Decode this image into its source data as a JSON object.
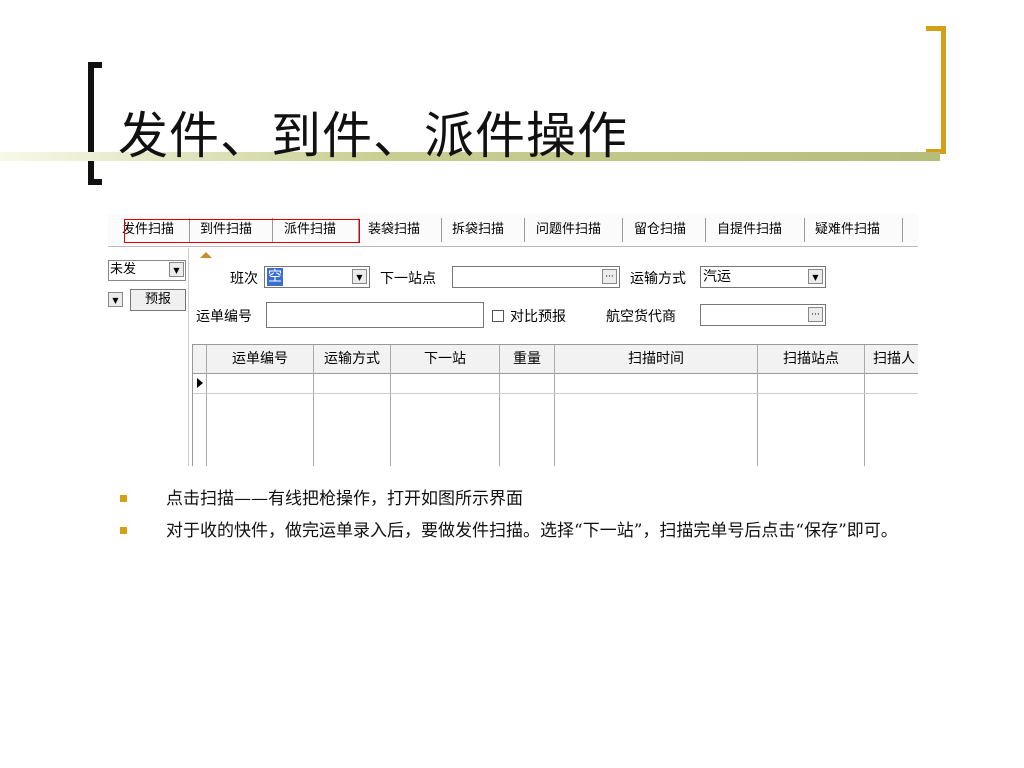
{
  "slide": {
    "title": "发件、到件、派件操作",
    "accent_color": "#d4a017"
  },
  "app": {
    "tabs": [
      {
        "label": "发件扫描"
      },
      {
        "label": "到件扫描"
      },
      {
        "label": "派件扫描"
      },
      {
        "label": "装袋扫描"
      },
      {
        "label": "拆袋扫描"
      },
      {
        "label": "问题件扫描"
      },
      {
        "label": "留仓扫描"
      },
      {
        "label": "自提件扫描"
      },
      {
        "label": "疑难件扫描"
      }
    ],
    "left_panel": {
      "status_value": "未发",
      "preview_button": "预报"
    },
    "form": {
      "shift_label": "班次",
      "shift_value": "空",
      "next_station_label": "下一站点",
      "next_station_value": "",
      "transport_label": "运输方式",
      "transport_value": "汽运",
      "waybill_label": "运单编号",
      "waybill_value": "",
      "compare_label": "对比预报",
      "forwarder_label": "航空货代商",
      "forwarder_value": "",
      "ellipsis": "···"
    },
    "grid": {
      "columns": [
        "运单编号",
        "运输方式",
        "下一站",
        "重量",
        "扫描时间",
        "扫描站点",
        "扫描人"
      ]
    }
  },
  "bullets": [
    "点击扫描——有线把枪操作，打开如图所示界面",
    "对于收的快件，做完运单录入后，要做发件扫描。选择“下一站”，扫描完单号后点击“保存”即可。"
  ]
}
